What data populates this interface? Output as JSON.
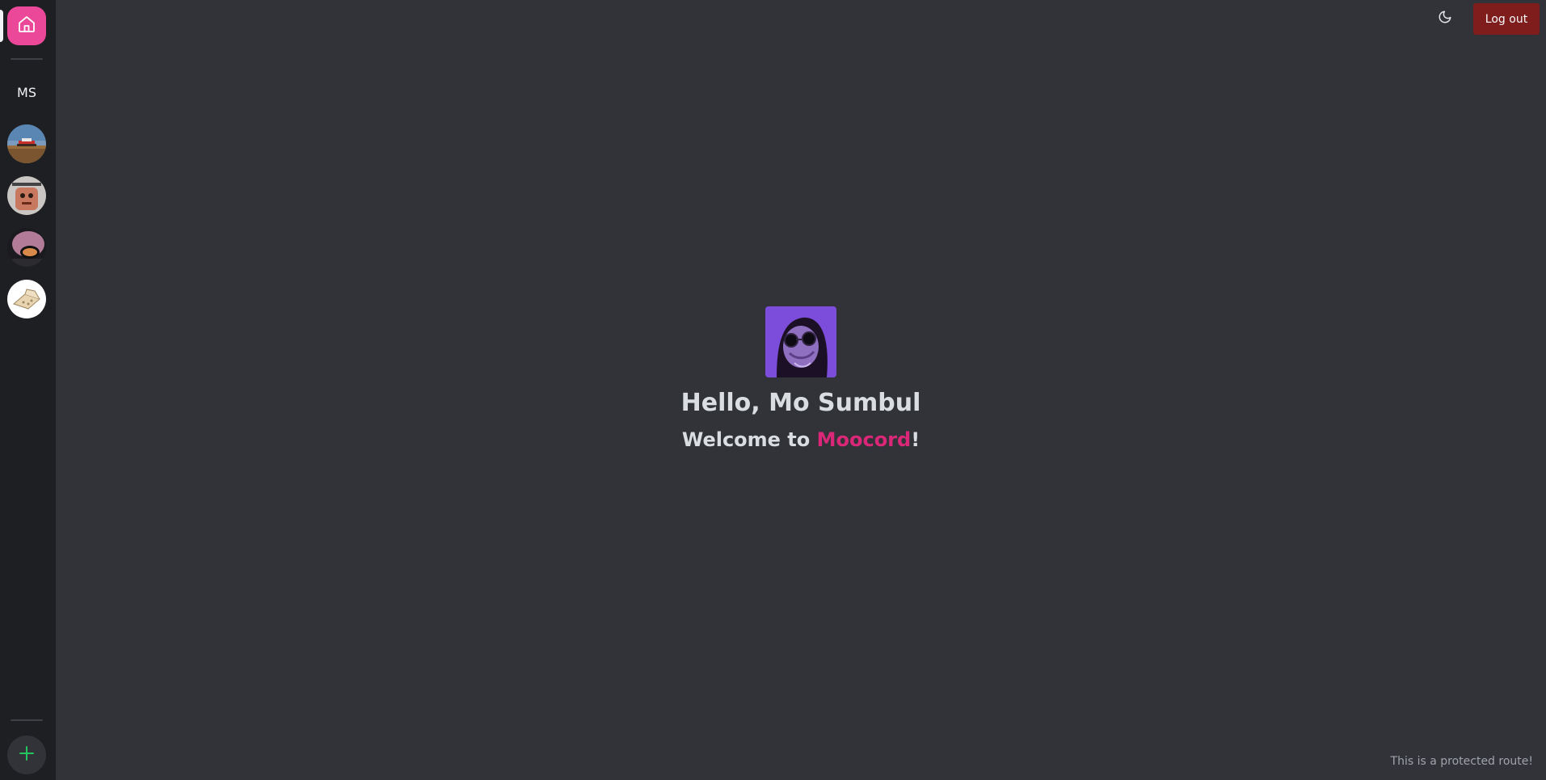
{
  "sidebar": {
    "home_icon": "home-icon",
    "user_initials": "MS",
    "servers": [
      {
        "icon": "server-avatar-landscape"
      },
      {
        "icon": "server-avatar-face"
      },
      {
        "icon": "server-avatar-dark"
      },
      {
        "icon": "server-avatar-sketch"
      }
    ],
    "add_icon": "plus-icon"
  },
  "header": {
    "theme_icon": "moon-icon",
    "logout_label": "Log out"
  },
  "main": {
    "hello": "Hello, Mo Sumbul",
    "welcome_prefix": "Welcome to ",
    "brand": "Moocord",
    "welcome_suffix": "!"
  },
  "footer": {
    "note": "This is a protected route!"
  },
  "colors": {
    "accent": "#ec4899",
    "brand_text": "#db2777",
    "logout_bg": "#7f1d1d",
    "add_icon": "#22c55e",
    "background": "#313338",
    "sidebar": "#1e1f22"
  }
}
